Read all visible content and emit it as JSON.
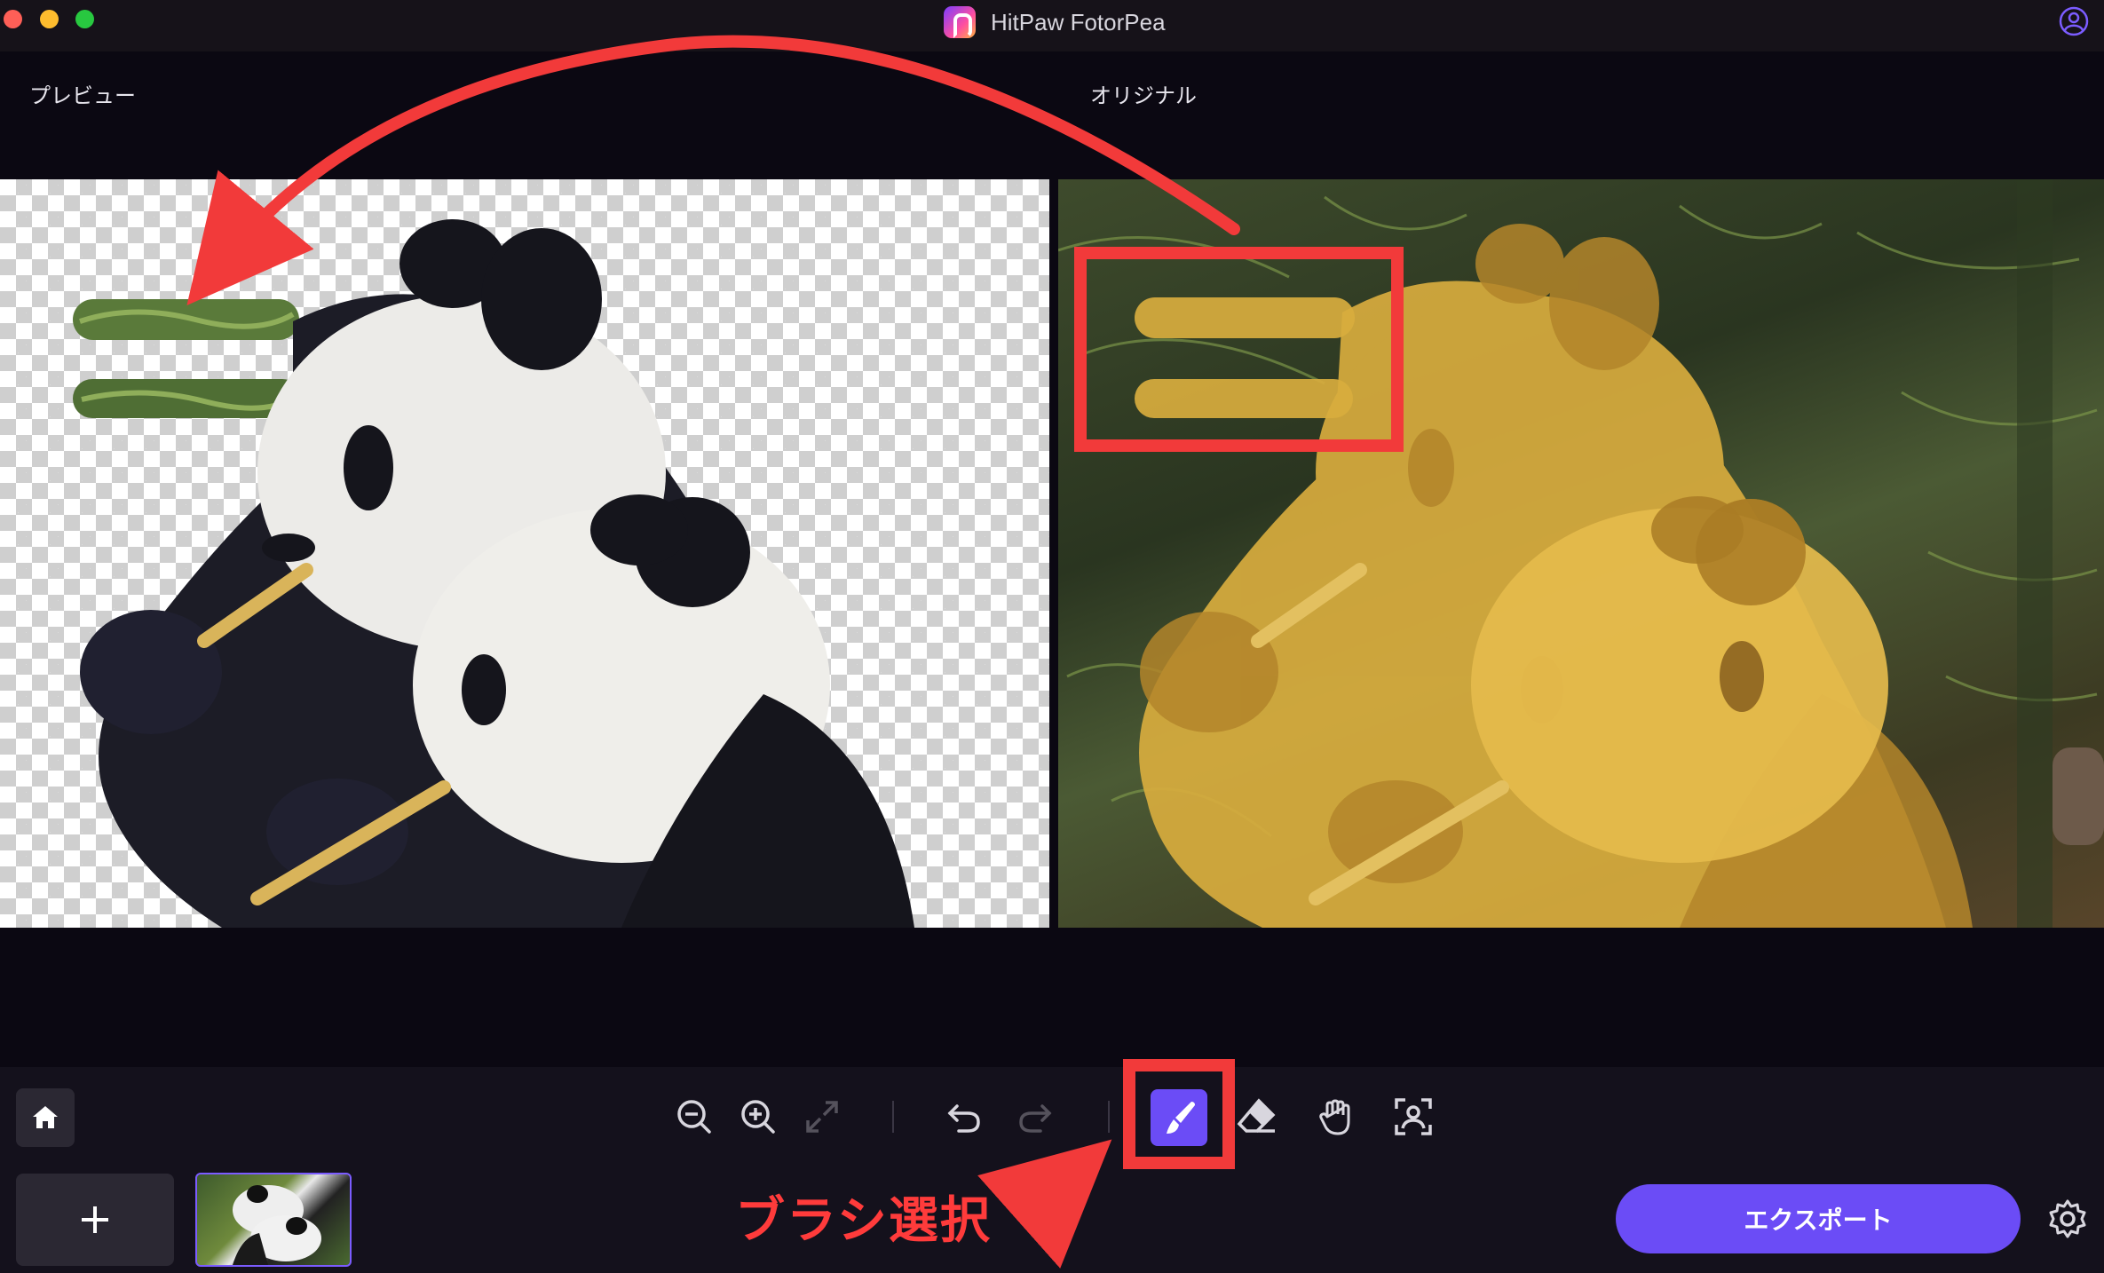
{
  "window": {
    "app_title": "HitPaw FotorPea",
    "account_icon": "user-account-icon"
  },
  "panels": {
    "preview_label": "プレビュー",
    "original_label": "オリジナル"
  },
  "toolbar": {
    "home_icon": "home-icon",
    "tools": [
      {
        "name": "zoom-out-icon"
      },
      {
        "name": "zoom-in-icon"
      },
      {
        "name": "fit-screen-icon"
      },
      {
        "name": "undo-icon"
      },
      {
        "name": "redo-icon"
      },
      {
        "name": "brush-icon",
        "active": true
      },
      {
        "name": "eraser-icon"
      },
      {
        "name": "hand-icon"
      },
      {
        "name": "subject-select-icon"
      }
    ],
    "add_icon": "plus-icon",
    "export_label": "エクスポート",
    "settings_icon": "gear-icon"
  },
  "annotation": {
    "text": "ブラシ選択",
    "color": "#ff3b3b"
  },
  "colors": {
    "accent": "#6b4cf6",
    "background": "#0b0812",
    "annotation_red": "#ff3b3b",
    "mask_yellow": "#e8b840"
  }
}
